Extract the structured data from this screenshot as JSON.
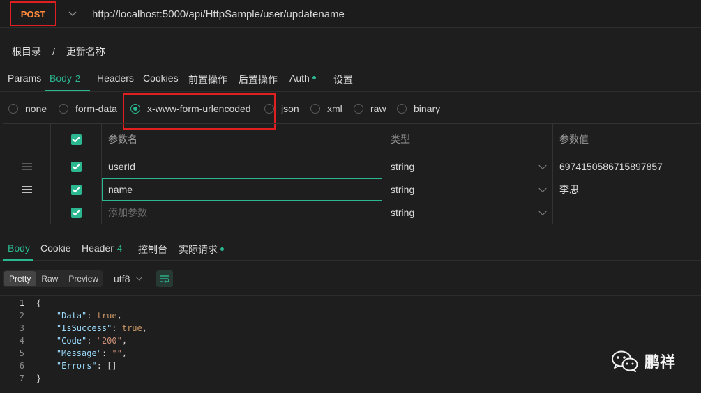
{
  "request": {
    "method": "POST",
    "url": "http://localhost:5000/api/HttpSample/user/updatename"
  },
  "breadcrumb": {
    "root": "根目录",
    "separator": "/",
    "current": "更新名称"
  },
  "tabs": {
    "params": "Params",
    "body": "Body",
    "body_count": "2",
    "headers": "Headers",
    "cookies": "Cookies",
    "pre": "前置操作",
    "post": "后置操作",
    "auth": "Auth",
    "settings": "设置"
  },
  "body_types": {
    "none": "none",
    "form_data": "form-data",
    "urlencoded": "x-www-form-urlencoded",
    "json": "json",
    "xml": "xml",
    "raw": "raw",
    "binary": "binary",
    "selected": "x-www-form-urlencoded"
  },
  "param_table": {
    "headers": {
      "name": "参数名",
      "type": "类型",
      "value": "参数值"
    },
    "rows": [
      {
        "name": "userId",
        "type": "string",
        "value": "6974150586715897857"
      },
      {
        "name": "name",
        "type": "string",
        "value": "李思"
      }
    ],
    "add_placeholder": "添加参数",
    "add_type": "string"
  },
  "response_tabs": {
    "body": "Body",
    "cookie": "Cookie",
    "header": "Header",
    "header_count": "4",
    "console": "控制台",
    "actual": "实际请求"
  },
  "view": {
    "pretty": "Pretty",
    "raw": "Raw",
    "preview": "Preview",
    "encoding": "utf8"
  },
  "code_lines": {
    "n1": "1",
    "n2": "2",
    "n3": "3",
    "n4": "4",
    "n5": "5",
    "n6": "6",
    "n7": "7",
    "open": "{",
    "close": "}",
    "data_key": "\"Data\"",
    "data_val": "true",
    "success_key": "\"IsSuccess\"",
    "success_val": "true",
    "code_key": "\"Code\"",
    "code_val": "\"200\"",
    "message_key": "\"Message\"",
    "message_val": "\"\"",
    "errors_key": "\"Errors\"",
    "errors_val": "[]"
  },
  "watermark": {
    "text": "鹏祥",
    "icon": "wechat-icon"
  },
  "colors": {
    "accent": "#2bb78f",
    "method": "#ff8a3d",
    "highlight": "#e02020"
  }
}
